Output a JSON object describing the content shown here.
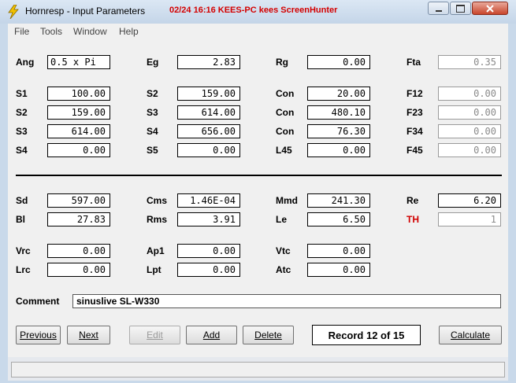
{
  "window": {
    "title": "Hornresp - Input Parameters",
    "overlay": "02/24 16:16 KEES-PC kees ScreenHunter"
  },
  "menu": [
    "File",
    "Tools",
    "Window",
    "Help"
  ],
  "params": {
    "Ang": {
      "label": "Ang",
      "value": "0.5 x Pi"
    },
    "Eg": {
      "label": "Eg",
      "value": "2.83"
    },
    "Rg": {
      "label": "Rg",
      "value": "0.00"
    },
    "Fta": {
      "label": "Fta",
      "value": "0.35"
    },
    "S1": {
      "label": "S1",
      "value": "100.00"
    },
    "S2a": {
      "label": "S2",
      "value": "159.00"
    },
    "Con1": {
      "label": "Con",
      "value": "20.00"
    },
    "F12": {
      "label": "F12",
      "value": "0.00"
    },
    "S2b": {
      "label": "S2",
      "value": "159.00"
    },
    "S3a": {
      "label": "S3",
      "value": "614.00"
    },
    "Con2": {
      "label": "Con",
      "value": "480.10"
    },
    "F23": {
      "label": "F23",
      "value": "0.00"
    },
    "S3b": {
      "label": "S3",
      "value": "614.00"
    },
    "S4a": {
      "label": "S4",
      "value": "656.00"
    },
    "Con3": {
      "label": "Con",
      "value": "76.30"
    },
    "F34": {
      "label": "F34",
      "value": "0.00"
    },
    "S4b": {
      "label": "S4",
      "value": "0.00"
    },
    "S5": {
      "label": "S5",
      "value": "0.00"
    },
    "L45": {
      "label": "L45",
      "value": "0.00"
    },
    "F45": {
      "label": "F45",
      "value": "0.00"
    },
    "Sd": {
      "label": "Sd",
      "value": "597.00"
    },
    "Cms": {
      "label": "Cms",
      "value": "1.46E-04"
    },
    "Mmd": {
      "label": "Mmd",
      "value": "241.30"
    },
    "Re": {
      "label": "Re",
      "value": "6.20"
    },
    "Bl": {
      "label": "Bl",
      "value": "27.83"
    },
    "Rms": {
      "label": "Rms",
      "value": "3.91"
    },
    "Le": {
      "label": "Le",
      "value": "6.50"
    },
    "TH": {
      "label": "TH",
      "value": "1"
    },
    "Vrc": {
      "label": "Vrc",
      "value": "0.00"
    },
    "Ap1": {
      "label": "Ap1",
      "value": "0.00"
    },
    "Vtc": {
      "label": "Vtc",
      "value": "0.00"
    },
    "Lrc": {
      "label": "Lrc",
      "value": "0.00"
    },
    "Lpt": {
      "label": "Lpt",
      "value": "0.00"
    },
    "Atc": {
      "label": "Atc",
      "value": "0.00"
    }
  },
  "comment": {
    "label": "Comment",
    "value": "sinuslive SL-W330"
  },
  "buttons": {
    "previous": "Previous",
    "next": "Next",
    "edit": "Edit",
    "add": "Add",
    "delete": "Delete",
    "calculate": "Calculate"
  },
  "record": "Record 12 of 15",
  "colors": {
    "accent_red": "#d10000",
    "title_overlay": "#d40000"
  }
}
